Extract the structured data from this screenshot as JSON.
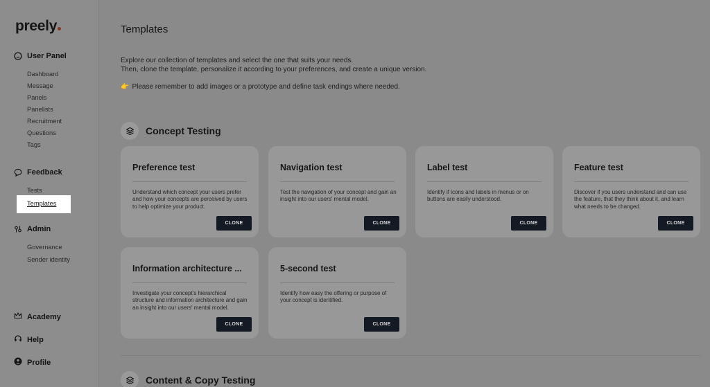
{
  "sidebar": {
    "logo": "preely",
    "sections": [
      {
        "title": "User Panel",
        "icon": "smiley-icon",
        "items": [
          "Dashboard",
          "Message",
          "Panels",
          "Panelists",
          "Recruitment",
          "Questions",
          "Tags"
        ]
      },
      {
        "title": "Feedback",
        "icon": "chat-bubble-icon",
        "items": [
          "Tests",
          "Templates"
        ],
        "active": "Templates"
      },
      {
        "title": "Admin",
        "icon": "settings-sliders-icon",
        "items": [
          "Governance",
          "Sender identity"
        ]
      }
    ],
    "bottom": [
      {
        "label": "Academy",
        "icon": "crown-icon"
      },
      {
        "label": "Help",
        "icon": "headset-icon"
      },
      {
        "label": "Profile",
        "icon": "profile-icon"
      }
    ]
  },
  "main": {
    "title": "Templates",
    "intro_line1": "Explore our collection of templates and select the one that suits your needs.",
    "intro_line2": "Then, clone the template, personalize it according to your preferences, and create a unique version.",
    "reminder_emoji": "👉",
    "reminder": "Please remember to add images or a prototype and define task endings where needed.",
    "categories": [
      {
        "title": "Concept Testing",
        "icon": "layers-icon",
        "cards": [
          {
            "title": "Preference test",
            "desc": "Understand which concept your users prefer and how your concepts are perceived by users to help optimize your product.",
            "button": "CLONE"
          },
          {
            "title": "Navigation test",
            "desc": "Test the navigation of your concept and gain an insight into our users' mental model.",
            "button": "CLONE"
          },
          {
            "title": "Label test",
            "desc": "Identify if icons and labels in menus or on buttons are easily understood.",
            "button": "CLONE"
          },
          {
            "title": "Feature test",
            "desc": "Discover if you users understand and can use the feature, that they think about it, and learn what needs to be changed.",
            "button": "CLONE"
          },
          {
            "title": "Information architecture ...",
            "desc": "Investigate your concept's hierarchical structure and information architecture and gain an insight into our users' mental model.",
            "button": "CLONE"
          },
          {
            "title": "5-second test",
            "desc": "Identify how easy the offering or purpose of your concept is identified.",
            "button": "CLONE"
          }
        ]
      },
      {
        "title": "Content & Copy Testing",
        "icon": "layers-icon"
      }
    ]
  },
  "colors": {
    "overlay": "#8a8a8a",
    "button": "#141a24",
    "logo_dot": "#8a3a22"
  }
}
